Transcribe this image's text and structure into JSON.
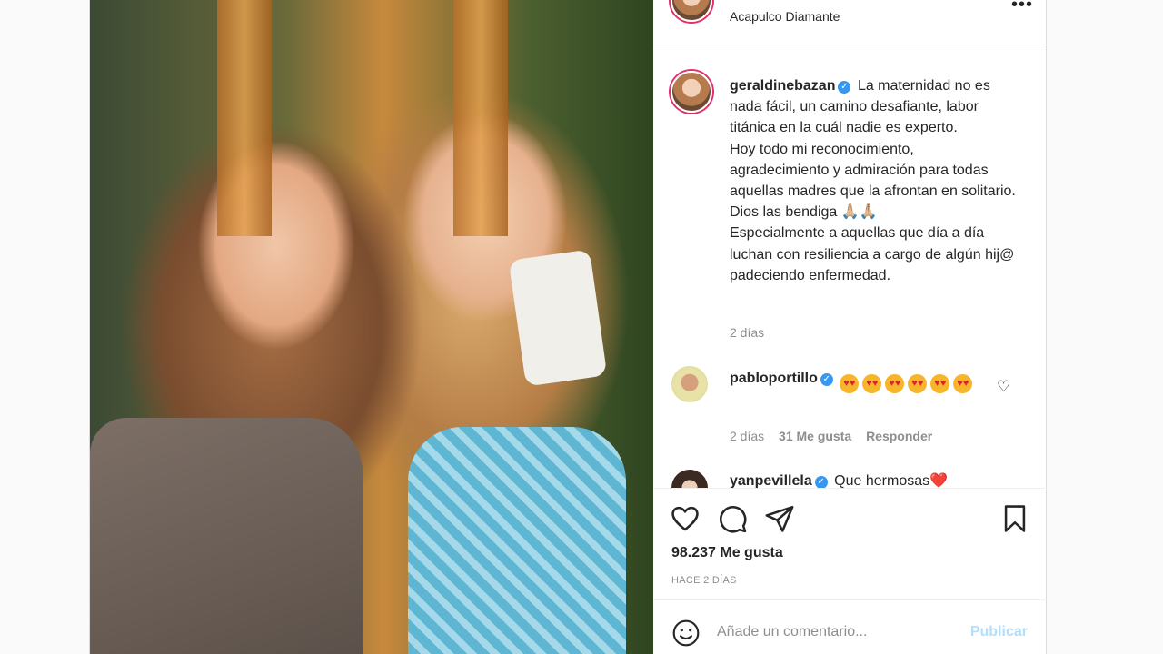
{
  "post": {
    "location": "Acapulco Diamante",
    "more_icon": "•••",
    "caption": {
      "username": "geraldinebazan",
      "text": "La maternidad no es nada fácil, un camino desafiante, labor titánica en la cuál nadie es experto.",
      "text2": "Hoy todo mi reconocimiento, agradecimiento y admiración para todas aquellas madres que la afrontan en solitario. Dios las bendiga",
      "emoji": "🙏🏼🙏🏼",
      "text3": "Especialmente a aquellas que día a día luchan con resiliencia a cargo de algún hij@ padeciendo enfermedad.",
      "time": "2 días"
    },
    "comments": [
      {
        "username": "pabloportillo",
        "emoji_name": "heart-eyes-emoji",
        "emoji_count": 6,
        "time": "2 días",
        "likes": "31 Me gusta",
        "reply": "Responder"
      },
      {
        "username": "yanpevillela",
        "text": "Que hermosas",
        "emoji": "❤️"
      }
    ],
    "likes": "98.237 Me gusta",
    "ago": "HACE 2 DÍAS",
    "add_comment_placeholder": "Añade un comentario...",
    "publish_label": "Publicar"
  },
  "colors": {
    "link_blue": "#3897f0",
    "publish_disabled": "#b2dffc",
    "secondary_text": "#8e8e8e"
  }
}
